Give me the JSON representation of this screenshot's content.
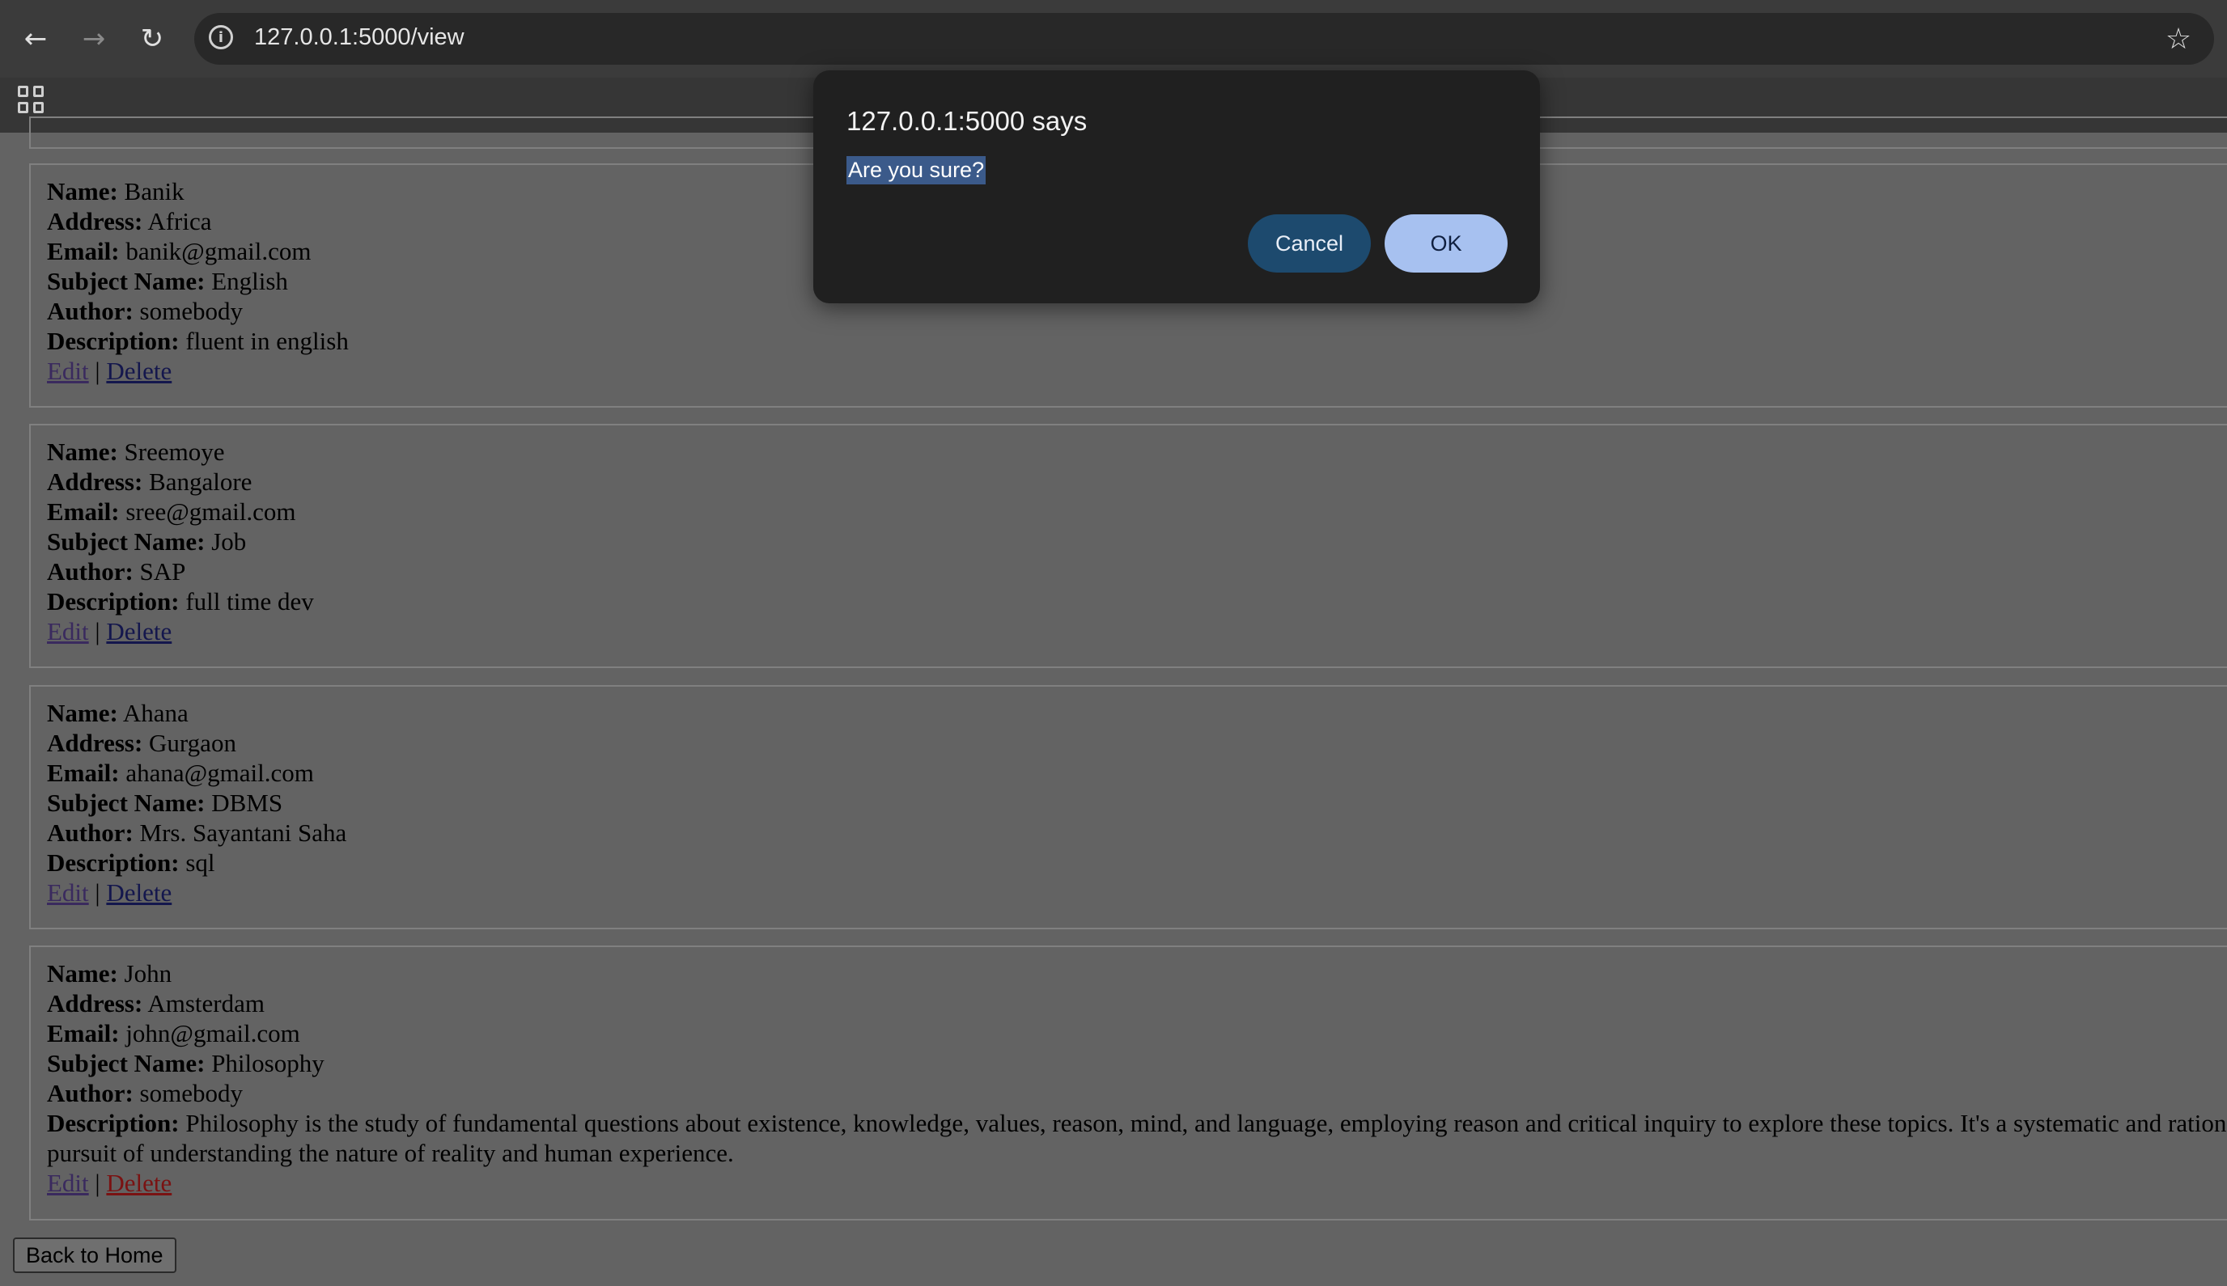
{
  "browser": {
    "url": "127.0.0.1:5000/view",
    "back_icon": "←",
    "forward_icon": "→",
    "reload_icon": "↻",
    "info_icon": "i",
    "star_icon": "☆"
  },
  "dialog": {
    "title": "127.0.0.1:5000 says",
    "message": "Are you sure?",
    "cancel_label": "Cancel",
    "ok_label": "OK"
  },
  "labels": {
    "name": "Name:",
    "address": "Address:",
    "email": "Email:",
    "subject": "Subject Name:",
    "author": "Author:",
    "description": "Description:",
    "edit": "Edit",
    "separator": "|",
    "delete": "Delete"
  },
  "records": [
    {
      "name": "Banik",
      "address": "Africa",
      "email": "banik@gmail.com",
      "subject": "English",
      "author": "somebody",
      "description": "fluent in english"
    },
    {
      "name": "Sreemoye",
      "address": "Bangalore",
      "email": "sree@gmail.com",
      "subject": "Job",
      "author": "SAP",
      "description": "full time dev"
    },
    {
      "name": "Ahana",
      "address": "Gurgaon",
      "email": "ahana@gmail.com",
      "subject": "DBMS",
      "author": "Mrs. Sayantani Saha",
      "description": "sql"
    },
    {
      "name": "John",
      "address": "Amsterdam",
      "email": "john@gmail.com",
      "subject": "Philosophy",
      "author": "somebody",
      "description": "Philosophy is the study of fundamental questions about existence, knowledge, values, reason, mind, and language, employing reason and critical inquiry to explore these topics. It's a systematic and rational pursuit of understanding the nature of reality and human experience."
    }
  ],
  "back_button": "Back to Home"
}
